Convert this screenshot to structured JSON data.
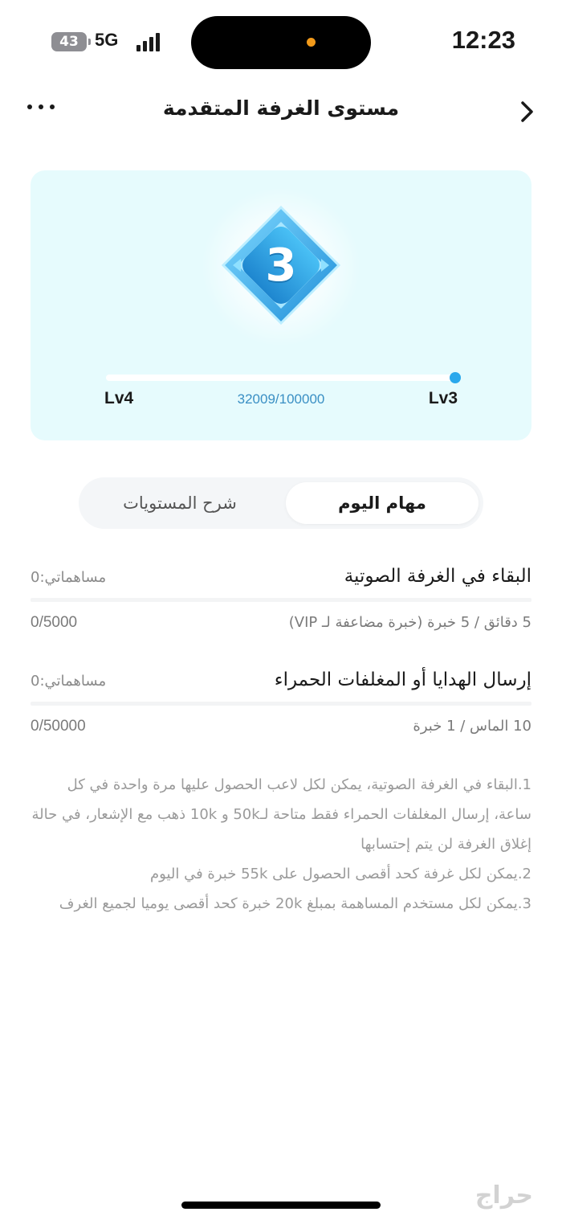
{
  "status_bar": {
    "battery": "43",
    "network": "5G",
    "time": "12:23"
  },
  "header": {
    "title": "مستوى الغرفة المتقدمة"
  },
  "level_card": {
    "badge_level": "3",
    "current_level": "Lv3",
    "next_level": "Lv4",
    "progress_text": "32009/100000",
    "progress_fraction": 0.32,
    "colors": {
      "badge": "#2aa8ec",
      "card_bg": "#e6fbfd",
      "progress_text": "#3a8fc4"
    }
  },
  "tabs": [
    {
      "label": "مهام اليوم",
      "active": true
    },
    {
      "label": "شرح المستويات",
      "active": false
    }
  ],
  "tasks": [
    {
      "title": "البقاء في الغرفة الصوتية",
      "contribution": "مساهماتي:0",
      "rule": "5 دقائق / 5 خبرة (خبرة مضاعفة لـ VIP)",
      "count": "0/5000"
    },
    {
      "title": "إرسال الهدايا أو المغلفات الحمراء",
      "contribution": "مساهماتي:0",
      "rule": "10 الماس / 1 خبرة",
      "count": "0/50000"
    }
  ],
  "notes": [
    "1.البقاء في الغرفة الصوتية، يمكن لكل لاعب الحصول عليها مرة واحدة في كل ساعة، إرسال المغلفات الحمراء فقط متاحة لـ50k و 10k ذهب مع الإشعار، في حالة إغلاق الغرفة لن يتم إحتسابها",
    "2.يمكن لكل غرفة كحد أقصى الحصول على 55k خبرة في اليوم",
    "3.يمكن لكل مستخدم المساهمة بمبلغ 20k خبرة كحد أقصى يوميا لجميع الغرف"
  ],
  "watermark": "حراج"
}
